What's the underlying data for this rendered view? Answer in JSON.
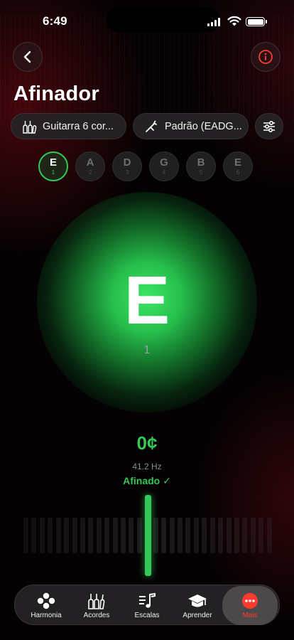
{
  "status_bar": {
    "time": "6:49"
  },
  "header": {
    "title": "Afinador"
  },
  "controls": {
    "instrument_label": "Guitarra 6 cor...",
    "instrument_icon": "guitar-icon",
    "tuning_label": "Padrão (EADG...",
    "tuning_icon": "tuning-fork-icon",
    "settings_icon": "sliders-icon"
  },
  "strings": [
    {
      "note": "E",
      "number": "1",
      "active": true
    },
    {
      "note": "A",
      "number": "2",
      "active": false
    },
    {
      "note": "D",
      "number": "3",
      "active": false
    },
    {
      "note": "G",
      "number": "4",
      "active": false
    },
    {
      "note": "B",
      "number": "5",
      "active": false
    },
    {
      "note": "E",
      "number": "6",
      "active": false
    }
  ],
  "tuner": {
    "note": "E",
    "string_number": "1",
    "cents": "0¢",
    "frequency": "41.2 Hz",
    "status": "Afinado ✓",
    "deviation_cents": 0
  },
  "tabbar": {
    "items": [
      {
        "label": "Harmonia",
        "icon": "harmony-dots-icon",
        "active": false
      },
      {
        "label": "Acordes",
        "icon": "chord-guitar-icon",
        "active": false
      },
      {
        "label": "Escalas",
        "icon": "music-notes-icon",
        "active": false
      },
      {
        "label": "Aprender",
        "icon": "graduation-cap-icon",
        "active": false
      },
      {
        "label": "Mais",
        "icon": "more-icon",
        "active": true
      }
    ]
  },
  "colors": {
    "accent_green": "#34c759",
    "accent_red": "#ff3b30"
  }
}
